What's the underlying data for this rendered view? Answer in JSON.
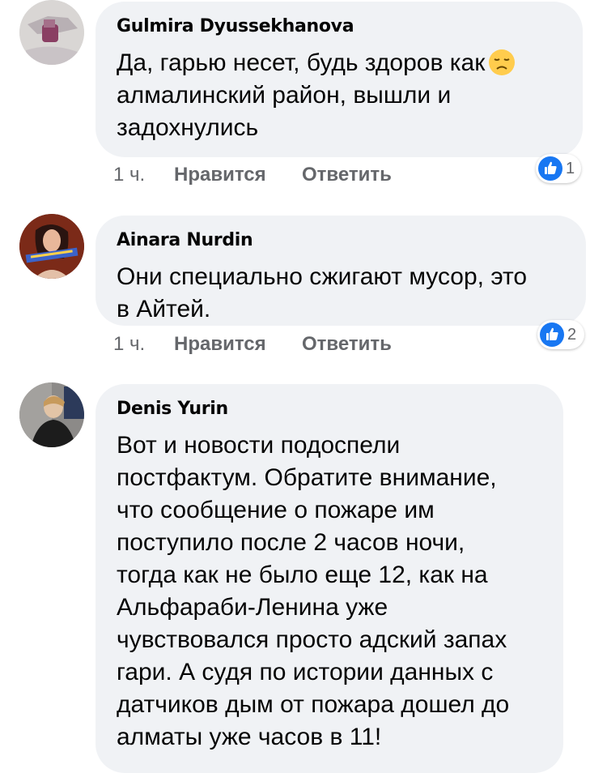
{
  "comments": [
    {
      "author": "Gulmira Dyussekhanova",
      "lines": [
        "Да, гарью несет, будь здоров как",
        "алмалинский район, вышли и",
        "задохнулись"
      ],
      "emoji": "disappointed-face-emoji",
      "time": "1 ч.",
      "like_label": "Нравится",
      "reply_label": "Ответить",
      "reaction": "like-icon",
      "reaction_count": "1"
    },
    {
      "author": "Ainara Nurdin",
      "lines": [
        "Они специально сжигают мусор, это",
        "в Айтей."
      ],
      "time": "1 ч.",
      "like_label": "Нравится",
      "reply_label": "Ответить",
      "reaction": "like-icon",
      "reaction_count": "2"
    },
    {
      "author": "Denis Yurin",
      "lines": [
        "Вот и новости подоспели",
        "постфактум. Обратите внимание,",
        "что сообщение о пожаре им",
        "поступило после 2 часов ночи,",
        "тогда как не было еще 12, как на",
        "Альфараби-Ленина уже",
        "чувствовался просто адский запах",
        "гари. А судя по истории данных с",
        "датчиков дым от пожара дошел до",
        "алматы уже часов в 11!"
      ]
    }
  ],
  "colors": {
    "bubble": "#f0f2f5",
    "text": "#050505",
    "meta": "#65676b",
    "like_blue": "#1877f2"
  }
}
